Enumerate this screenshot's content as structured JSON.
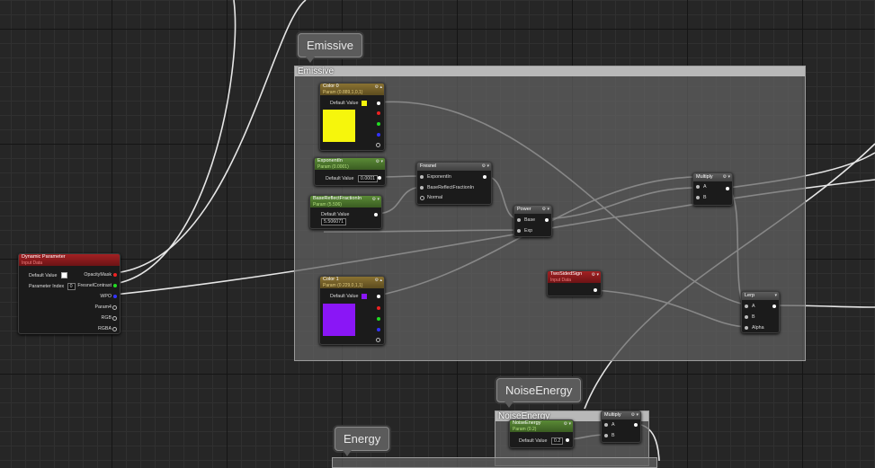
{
  "comments": {
    "emissive": {
      "bubble": "Emissive",
      "title": "Emissive"
    },
    "noise_energy": {
      "bubble": "NoiseEnergy",
      "title": "NoiseEnergy"
    },
    "energy": {
      "bubble": "Energy"
    }
  },
  "nodes": {
    "dynamic_param": {
      "title": "Dynamic Parameter",
      "subtitle": "Input Data",
      "default_label": "Default Value",
      "index_label": "Parameter Index",
      "index_value": "0",
      "outputs": [
        "OpacityMask",
        "FresnelContrast",
        "WPO",
        "Param4",
        "RGB",
        "RGBA"
      ],
      "output_colors": [
        "#ee3333",
        "#33dd33",
        "#3333ff",
        "#bbbbbb",
        "#bbbbbb",
        "#bbbbbb"
      ]
    },
    "color0": {
      "title": "Color 0",
      "subtitle": "Param (0.889,1,0,1)",
      "default_label": "Default Value",
      "swatch": "#f6f60c"
    },
    "color1": {
      "title": "Color 1",
      "subtitle": "Param (0.229,0,1,1)",
      "default_label": "Default Value",
      "swatch": "#8a16f6"
    },
    "exponentin": {
      "title": "ExponentIn",
      "subtitle": "Param (0.0001)",
      "default_label": "Default Value",
      "value": "0.0001"
    },
    "basereflect": {
      "title": "BaseReflectFractionIn",
      "subtitle": "Param (5.506)",
      "default_label": "Default Value",
      "value": "5.506071"
    },
    "fresnel": {
      "title": "Fresnel",
      "inputs": [
        "ExponentIn",
        "BaseReflectFractionIn",
        "Normal"
      ]
    },
    "power": {
      "title": "Power",
      "inputs": [
        "Base",
        "Exp"
      ]
    },
    "multiply1": {
      "title": "Multiply",
      "inputs": [
        "A",
        "B"
      ]
    },
    "twosided": {
      "title": "TwoSidedSign",
      "subtitle": "Input Data"
    },
    "lerp": {
      "title": "Lerp",
      "inputs": [
        "A",
        "B",
        "Alpha"
      ]
    },
    "noise_param": {
      "title": "NoiseEnergy",
      "subtitle": "Param (0.2)",
      "default_label": "Default Value",
      "value": "0.2"
    },
    "multiply2": {
      "title": "Multiply",
      "inputs": [
        "A",
        "B"
      ]
    }
  }
}
